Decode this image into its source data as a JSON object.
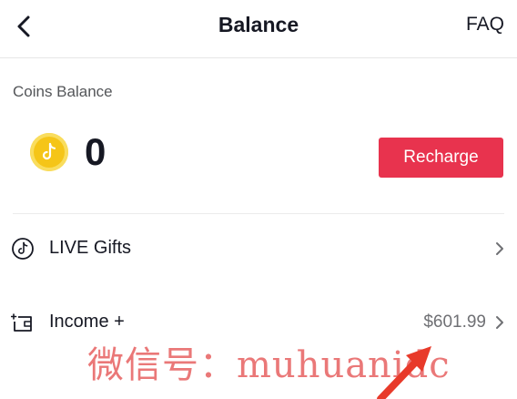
{
  "header": {
    "title": "Balance",
    "faq_label": "FAQ",
    "back_icon": "chevron-left-icon"
  },
  "coins": {
    "label": "Coins Balance",
    "value": "0",
    "icon": "tiktok-coin-icon",
    "recharge_label": "Recharge"
  },
  "rows": [
    {
      "label": "LIVE Gifts",
      "value": "",
      "icon": "live-gift-icon"
    },
    {
      "label": "Income +",
      "value": "$601.99",
      "icon": "wallet-icon"
    }
  ],
  "watermark": {
    "text": "微信号：muhuanidc"
  },
  "colors": {
    "accent": "#e8334e",
    "coin": "#f5c518",
    "text": "#161823",
    "secondary_text": "#545659",
    "watermark": "#e86a6a"
  }
}
